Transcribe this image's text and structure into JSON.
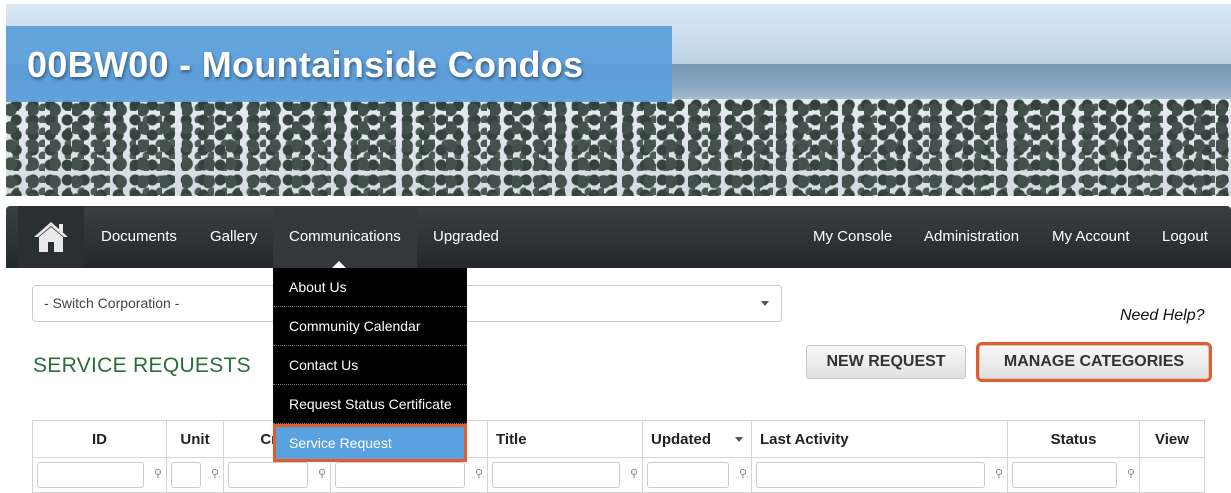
{
  "header": {
    "title": "00BW00 - Mountainside Condos"
  },
  "nav": {
    "home_icon": "home-icon",
    "left_items": [
      "Documents",
      "Gallery",
      "Communications",
      "Upgraded"
    ],
    "right_items": [
      "My Console",
      "Administration",
      "My Account",
      "Logout"
    ],
    "active_item": "Communications"
  },
  "dropdown": {
    "items": [
      "About Us",
      "Community Calendar",
      "Contact Us",
      "Request Status Certificate",
      "Service Request"
    ],
    "selected": "Service Request"
  },
  "switcher": {
    "value": "- Switch Corporation -"
  },
  "help": {
    "label": "Need Help?"
  },
  "page": {
    "title": "SERVICE REQUESTS",
    "new_request_label": "NEW REQUEST",
    "manage_categories_label": "MANAGE CATEGORIES"
  },
  "table": {
    "columns": [
      "ID",
      "Unit",
      "Crea",
      "",
      "Title",
      "Updated",
      "Last Activity",
      "Status",
      "View"
    ],
    "filter_icon": "key-icon"
  },
  "colors": {
    "accent_blue": "#5aa1e0",
    "highlight_orange": "#e35c2c",
    "section_green": "#2d6b3a"
  }
}
